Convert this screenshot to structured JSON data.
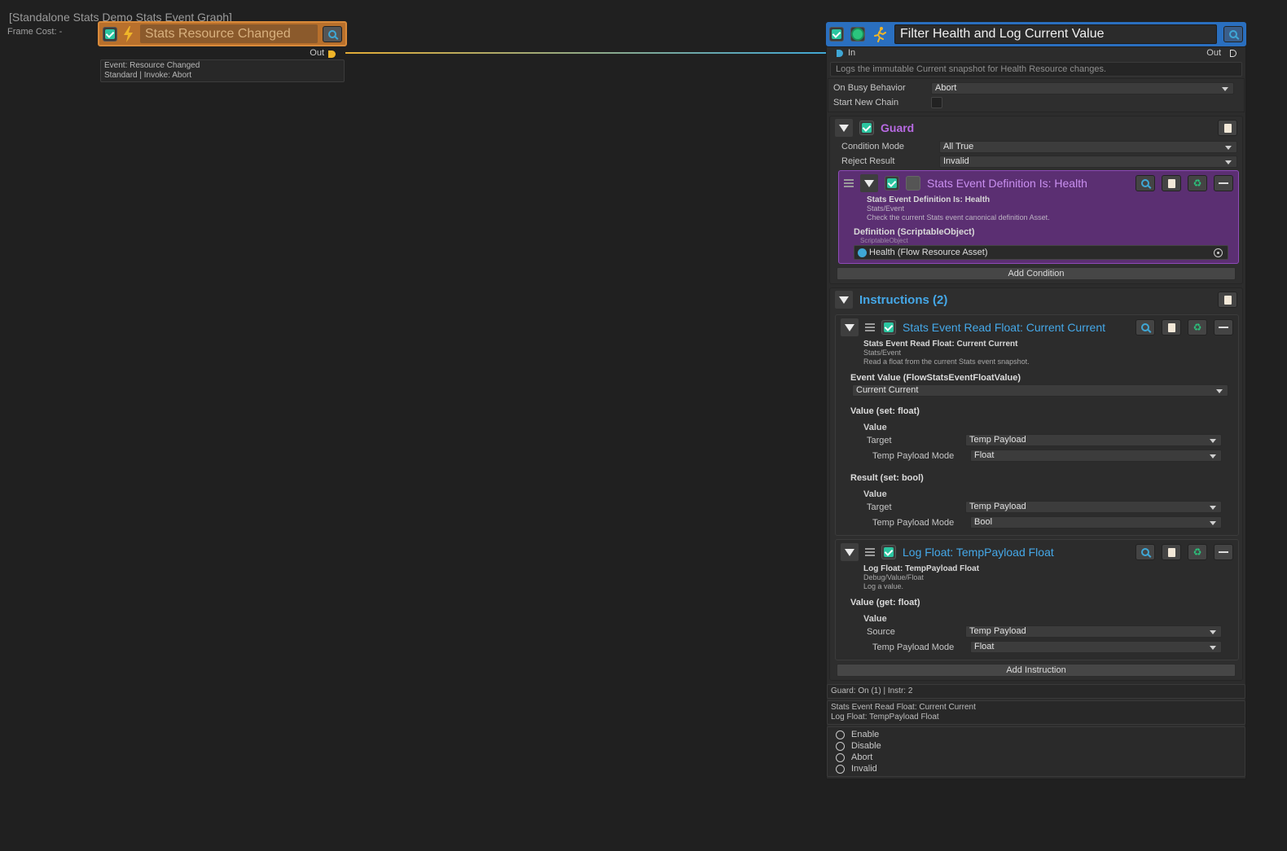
{
  "graph": {
    "title": "[Standalone Stats Demo Stats Event Graph]",
    "frame_cost": "Frame Cost: -"
  },
  "event_node": {
    "title": "Stats Resource Changed",
    "out_label": "Out",
    "info_line1": "Event: Resource Changed",
    "info_line2": "Standard | Invoke: Abort"
  },
  "main_node": {
    "title": "Filter Health and Log Current Value",
    "in_label": "In",
    "out_label": "Out",
    "description": "Logs the immutable Current snapshot for Health Resource changes.",
    "on_busy_label": "On Busy Behavior",
    "on_busy_value": "Abort",
    "start_chain_label": "Start New Chain",
    "guard": {
      "title": "Guard",
      "condition_mode_label": "Condition Mode",
      "condition_mode_value": "All True",
      "reject_result_label": "Reject Result",
      "reject_result_value": "Invalid",
      "condition": {
        "title": "Stats Event Definition Is: Health",
        "meta_title": "Stats Event Definition Is: Health",
        "meta_path": "Stats/Event",
        "meta_desc": "Check the current Stats event canonical definition Asset.",
        "field_title": "Definition (ScriptableObject)",
        "field_type": "ScriptableObject",
        "field_value": "Health (Flow Resource Asset)"
      },
      "add_condition": "Add Condition"
    },
    "instructions": {
      "title": "Instructions (2)",
      "read_float": {
        "title": "Stats Event Read Float: Current Current",
        "meta_title": "Stats Event Read Float: Current Current",
        "meta_path": "Stats/Event",
        "meta_desc": "Read a float from the current Stats event snapshot.",
        "event_value_label": "Event Value (FlowStatsEventFloatValue)",
        "event_value": "Current Current",
        "value_set_label": "Value (set: float)",
        "value_label": "Value",
        "target_label": "Target",
        "target_value": "Temp Payload",
        "payload_mode_label": "Temp Payload Mode",
        "payload_mode_value": "Float",
        "result_set_label": "Result (set: bool)",
        "result_value_label": "Value",
        "result_target_label": "Target",
        "result_target_value": "Temp Payload",
        "result_mode_label": "Temp Payload Mode",
        "result_mode_value": "Bool"
      },
      "log_float": {
        "title": "Log Float: TempPayload Float",
        "meta_title": "Log Float: TempPayload Float",
        "meta_path": "Debug/Value/Float",
        "meta_desc": "Log a value.",
        "value_get_label": "Value (get: float)",
        "value_label": "Value",
        "source_label": "Source",
        "source_value": "Temp Payload",
        "payload_mode_label": "Temp Payload Mode",
        "payload_mode_value": "Float"
      },
      "add_instruction": "Add Instruction"
    },
    "summary": "Guard: On (1) | Instr: 2",
    "instr_list_1": "Stats Event Read Float: Current Current",
    "instr_list_2": "Log Float: TempPayload Float",
    "radios": [
      "Enable",
      "Disable",
      "Abort",
      "Invalid"
    ]
  },
  "colors": {
    "event_accent": "#b8702c",
    "main_accent": "#2a6fbf",
    "guard_purple": "#5b2f72",
    "check_green": "#2bc5a0"
  },
  "icons": [
    "checkbox-icon",
    "lightning-icon",
    "search-icon",
    "running-figure-icon",
    "copy-icon",
    "recycle-icon",
    "minus-icon",
    "drag-handle-icon",
    "target-icon"
  ]
}
